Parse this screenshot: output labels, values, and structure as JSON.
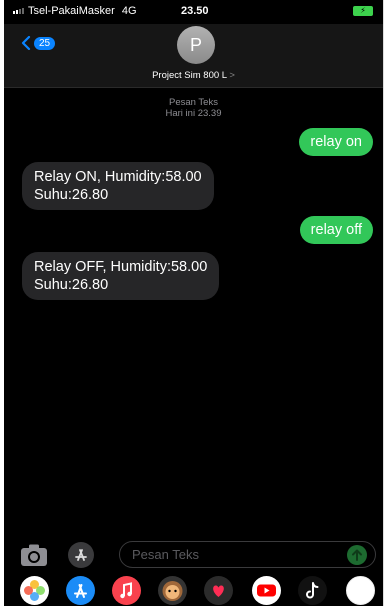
{
  "status_bar": {
    "carrier": "Tsel-PakaiMasker",
    "network": "4G",
    "time": "23.50"
  },
  "header": {
    "back_count": "25",
    "avatar_initial": "P",
    "contact_name": "Project Sim 800 L",
    "chevron": ">"
  },
  "thread": {
    "service": "Pesan Teks",
    "timestamp": "Hari ini 23.39",
    "messages": [
      {
        "direction": "sent",
        "text": "relay on"
      },
      {
        "direction": "received",
        "text": "Relay ON, Humidity:58.00\nSuhu:26.80"
      },
      {
        "direction": "sent",
        "text": "relay off"
      },
      {
        "direction": "received",
        "text": "Relay OFF, Humidity:58.00\nSuhu:26.80"
      }
    ]
  },
  "composer": {
    "placeholder": "Pesan Teks"
  },
  "apps": [
    "photos-icon",
    "app-store-icon",
    "music-icon",
    "memoji-icon",
    "digital-touch-icon",
    "youtube-icon",
    "tiktok-icon",
    "more-app-icon"
  ],
  "colors": {
    "sent_bubble": "#32c759",
    "received_bubble": "#262628",
    "accent": "#0a84ff"
  }
}
